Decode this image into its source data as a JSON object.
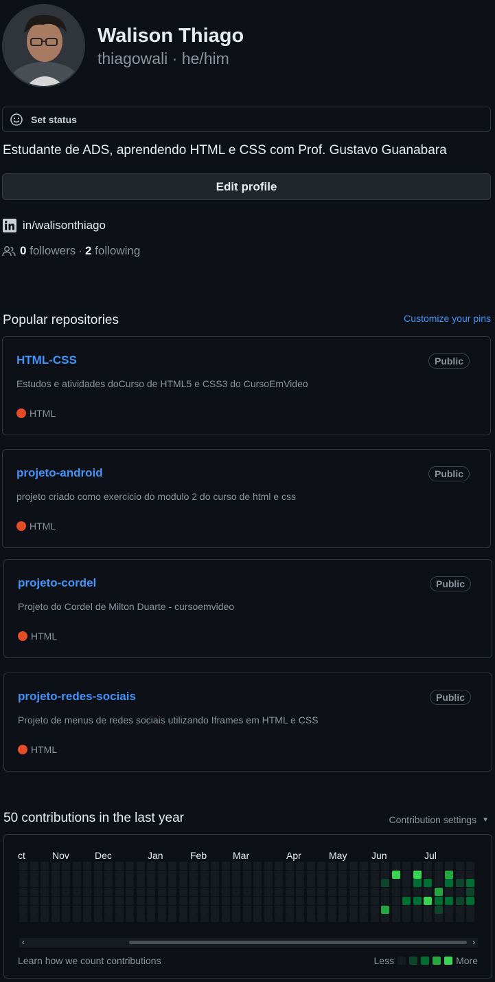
{
  "profile": {
    "name": "Walison Thiago",
    "login_pronouns": "thiagowali · he/him",
    "status_label": "Set status",
    "bio": "Estudante de ADS, aprendendo HTML e CSS com Prof. Gustavo Guanabara",
    "edit_label": "Edit profile",
    "linkedin": "in/walisonthiago",
    "followers_count": "0",
    "followers_label": "followers",
    "separator": "·",
    "following_count": "2",
    "following_label": "following"
  },
  "popular": {
    "title": "Popular repositories",
    "customize_label": "Customize your pins",
    "repos": [
      {
        "name": "HTML-CSS",
        "visibility": "Public",
        "description": "Estudos e atividades doCurso de HTML5 e CSS3 do CursoEmVideo",
        "language": "HTML",
        "language_color": "#e34c26"
      },
      {
        "name": "projeto-android",
        "visibility": "Public",
        "description": "projeto criado como exercicio do modulo 2 do curso de html e css",
        "language": "HTML",
        "language_color": "#e34c26"
      },
      {
        "name": "projeto-cordel",
        "visibility": "Public",
        "description": "Projeto do Cordel de Milton Duarte - cursoemvideo",
        "language": "HTML",
        "language_color": "#e34c26"
      },
      {
        "name": "projeto-redes-sociais",
        "visibility": "Public",
        "description": "Projeto de menus de redes sociais utilizando Iframes em HTML e CSS",
        "language": "HTML",
        "language_color": "#e34c26"
      }
    ]
  },
  "contributions": {
    "title": "50 contributions in the last year",
    "settings_label": "Contribution settings",
    "months": [
      "ct",
      "Nov",
      "Dec",
      "Jan",
      "Feb",
      "Mar",
      "Apr",
      "May",
      "Jun",
      "Jul"
    ],
    "learn_label": "Learn how we count contributions",
    "less_label": "Less",
    "more_label": "More",
    "level_colors": [
      "#161b22",
      "#0e4429",
      "#006d32",
      "#26a641",
      "#39d353"
    ],
    "legend_levels": [
      0,
      1,
      2,
      3,
      4
    ],
    "active_cells": [
      {
        "week": 35,
        "day": 1,
        "level": 4
      },
      {
        "week": 37,
        "day": 1,
        "level": 4
      },
      {
        "week": 40,
        "day": 1,
        "level": 3
      },
      {
        "week": 34,
        "day": 2,
        "level": 1
      },
      {
        "week": 37,
        "day": 2,
        "level": 2
      },
      {
        "week": 38,
        "day": 2,
        "level": 2
      },
      {
        "week": 40,
        "day": 2,
        "level": 2
      },
      {
        "week": 41,
        "day": 2,
        "level": 1
      },
      {
        "week": 42,
        "day": 2,
        "level": 2
      },
      {
        "week": 39,
        "day": 3,
        "level": 3
      },
      {
        "week": 42,
        "day": 3,
        "level": 1
      },
      {
        "week": 36,
        "day": 4,
        "level": 2
      },
      {
        "week": 37,
        "day": 4,
        "level": 2
      },
      {
        "week": 38,
        "day": 4,
        "level": 4
      },
      {
        "week": 39,
        "day": 4,
        "level": 2
      },
      {
        "week": 40,
        "day": 4,
        "level": 2
      },
      {
        "week": 41,
        "day": 4,
        "level": 1
      },
      {
        "week": 42,
        "day": 4,
        "level": 2
      },
      {
        "week": 34,
        "day": 5,
        "level": 3
      },
      {
        "week": 39,
        "day": 5,
        "level": 1
      }
    ],
    "weeks": 43,
    "days": 7
  }
}
